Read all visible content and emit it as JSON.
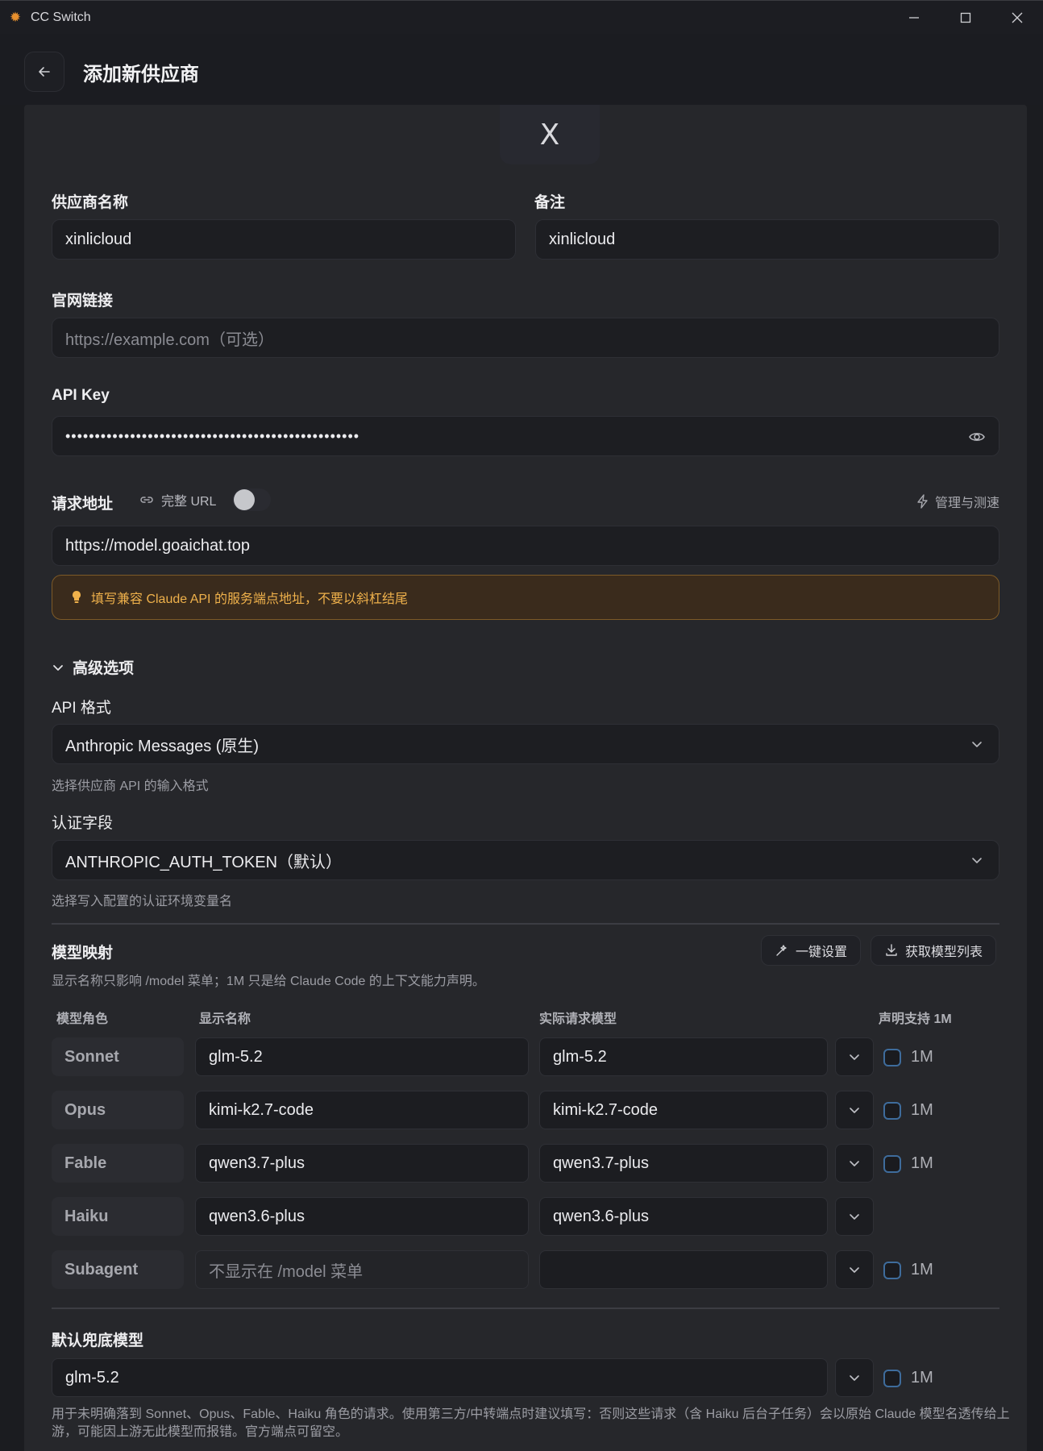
{
  "window": {
    "title": "CC Switch"
  },
  "header": {
    "title": "添加新供应商"
  },
  "logo": {
    "letter": "X"
  },
  "form": {
    "name_label": "供应商名称",
    "name_value": "xinlicloud",
    "notes_label": "备注",
    "notes_value": "xinlicloud",
    "website_label": "官网链接",
    "website_placeholder": "https://example.com（可选）",
    "apikey_label": "API Key",
    "apikey_value": "••••••••••••••••••••••••••••••••••••••••••••••••••",
    "endpoint_label": "请求地址",
    "full_url_label": "完整 URL",
    "full_url_enabled": false,
    "manage_test_label": "管理与测速",
    "endpoint_value": "https://model.goaichat.top",
    "endpoint_hint": "填写兼容 Claude API 的服务端点地址，不要以斜杠结尾"
  },
  "advanced": {
    "toggle_label": "高级选项",
    "api_format_label": "API 格式",
    "api_format_value": "Anthropic Messages (原生)",
    "api_format_hint": "选择供应商 API 的输入格式",
    "auth_field_label": "认证字段",
    "auth_field_value": "ANTHROPIC_AUTH_TOKEN（默认）",
    "auth_field_hint": "选择写入配置的认证环境变量名"
  },
  "model_mapping": {
    "title": "模型映射",
    "description": "显示名称只影响 /model 菜单；1M 只是给 Claude Code 的上下文能力声明。",
    "one_click_label": "一键设置",
    "fetch_models_label": "获取模型列表",
    "columns": [
      "模型角色",
      "显示名称",
      "实际请求模型",
      "声明支持 1M"
    ],
    "rows": [
      {
        "role": "Sonnet",
        "display": "glm-5.2",
        "model": "glm-5.2",
        "onem_label": "1M",
        "onem_checked": false
      },
      {
        "role": "Opus",
        "display": "kimi-k2.7-code",
        "model": "kimi-k2.7-code",
        "onem_label": "1M",
        "onem_checked": false
      },
      {
        "role": "Fable",
        "display": "qwen3.7-plus",
        "model": "qwen3.7-plus",
        "onem_label": "1M",
        "onem_checked": false
      },
      {
        "role": "Haiku",
        "display": "qwen3.6-plus",
        "model": "qwen3.6-plus"
      },
      {
        "role": "Subagent",
        "display_placeholder": "不显示在 /model 菜单",
        "model": "",
        "onem_label": "1M",
        "onem_checked": false
      }
    ]
  },
  "fallback": {
    "label": "默认兜底模型",
    "value": "glm-5.2",
    "onem_label": "1M",
    "note": "用于未明确落到 Sonnet、Opus、Fable、Haiku 角色的请求。使用第三方/中转端点时建议填写：否则这些请求（含 Haiku 后台子任务）会以原始 Claude 模型名透传给上游，可能因上游无此模型而报错。官方端点可留空。"
  },
  "icons": {
    "app": "sun-logo-icon",
    "back": "arrow-left-icon",
    "eye": "eye-icon",
    "link": "link-icon",
    "bolt": "lightning-icon",
    "bulb": "lightbulb-icon",
    "chevron": "chevron-down-icon",
    "wand": "magic-wand-icon",
    "download": "download-icon"
  },
  "colors": {
    "accent_warning": "#efb14b",
    "checkbox_border": "#3e6c9c"
  }
}
